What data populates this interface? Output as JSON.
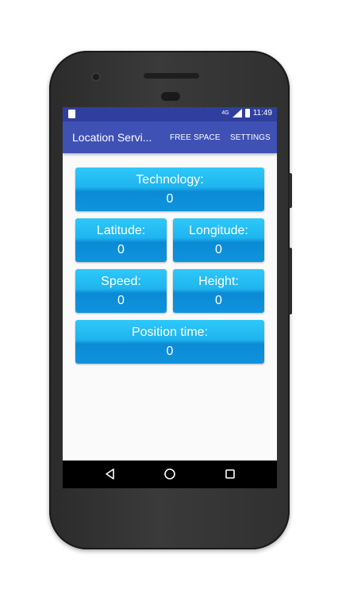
{
  "status_bar": {
    "network": "4G",
    "time": "11:49"
  },
  "app_bar": {
    "title": "Location Servi...",
    "actions": [
      "FREE SPACE",
      "SETTINGS"
    ]
  },
  "tiles": {
    "technology": {
      "label": "Technology:",
      "value": "0"
    },
    "latitude": {
      "label": "Latitude:",
      "value": "0"
    },
    "longitude": {
      "label": "Longitude:",
      "value": "0"
    },
    "speed": {
      "label": "Speed:",
      "value": "0"
    },
    "height": {
      "label": "Height:",
      "value": "0"
    },
    "position_time": {
      "label": "Position time:",
      "value": "0"
    }
  },
  "nav_bar": {
    "icons": [
      "back-icon",
      "home-icon",
      "recents-icon"
    ]
  },
  "colors": {
    "status_bar": "#303f9f",
    "app_bar": "#3f51b5",
    "tile": "#1fb4ee"
  }
}
